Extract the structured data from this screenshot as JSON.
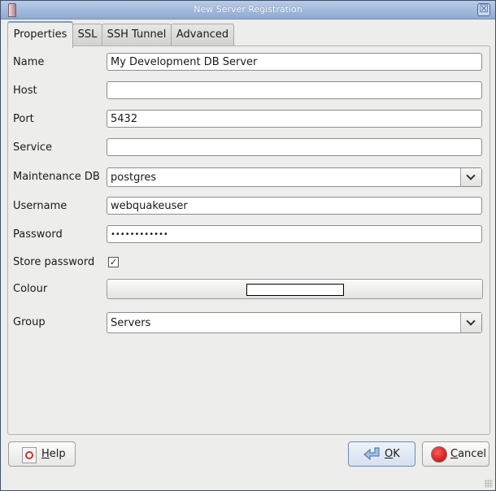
{
  "window": {
    "title": "New Server Registration"
  },
  "tabs": [
    {
      "label": "Properties",
      "active": true
    },
    {
      "label": "SSL",
      "active": false
    },
    {
      "label": "SSH Tunnel",
      "active": false
    },
    {
      "label": "Advanced",
      "active": false
    }
  ],
  "form": {
    "name": {
      "label": "Name",
      "value": "My Development DB Server"
    },
    "host": {
      "label": "Host",
      "value": ""
    },
    "port": {
      "label": "Port",
      "value": "5432"
    },
    "service": {
      "label": "Service",
      "value": ""
    },
    "maintenance_db": {
      "label": "Maintenance DB",
      "value": "postgres"
    },
    "username": {
      "label": "Username",
      "value": "webquakeuser"
    },
    "password": {
      "label": "Password",
      "value": "••••••••••••"
    },
    "store_password": {
      "label": "Store password",
      "checked": true,
      "glyph": "✓"
    },
    "colour": {
      "label": "Colour",
      "value": "#ffffff"
    },
    "group": {
      "label": "Group",
      "value": "Servers"
    }
  },
  "buttons": {
    "help": {
      "mnemonic": "H",
      "rest": "elp",
      "icon": "help-icon"
    },
    "ok": {
      "mnemonic": "O",
      "rest": "K",
      "icon": "return-arrow-icon"
    },
    "cancel": {
      "mnemonic": "C",
      "rest": "ancel",
      "icon": "stop-icon"
    }
  },
  "close_glyph": "☒"
}
